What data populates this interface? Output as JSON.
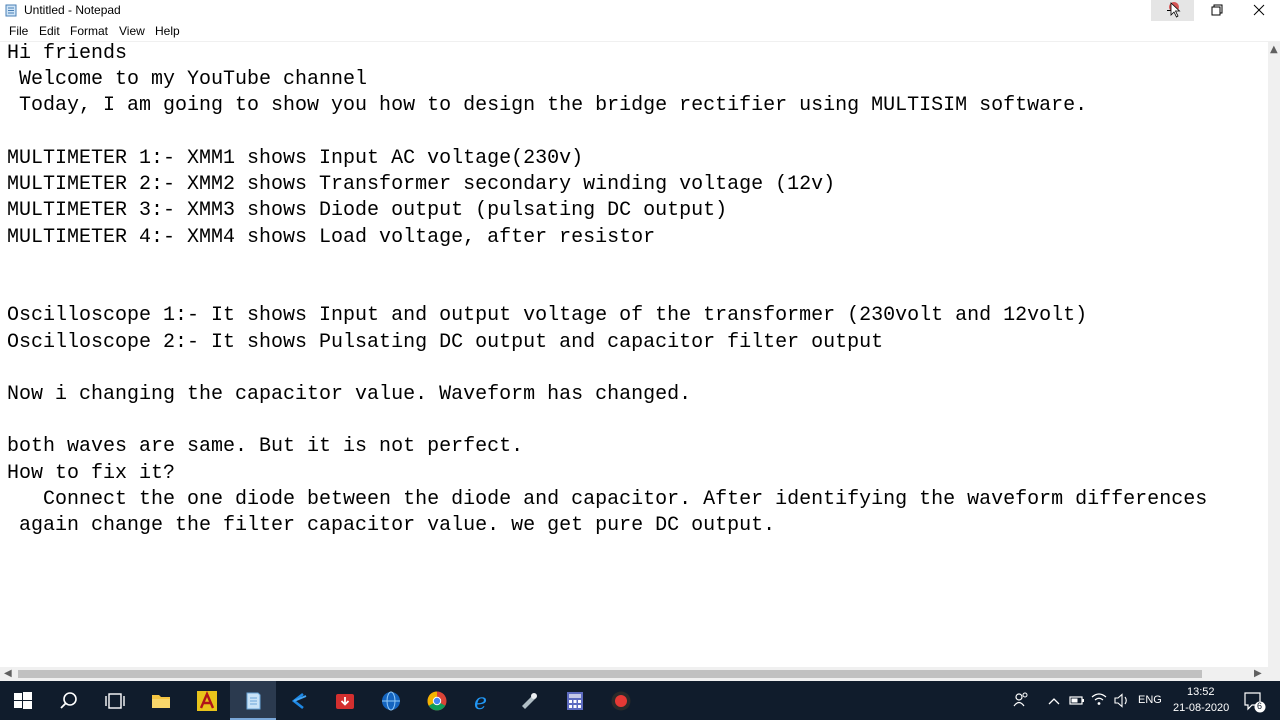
{
  "window": {
    "title": "Untitled - Notepad",
    "controls": {
      "minimize": "minimize",
      "maximize": "restore",
      "close": "close"
    }
  },
  "menu": [
    "File",
    "Edit",
    "Format",
    "View",
    "Help"
  ],
  "editor": {
    "lines": [
      "Hi friends",
      " Welcome to my YouTube channel",
      " Today, I am going to show you how to design the bridge rectifier using MULTISIM software.",
      "",
      "MULTIMETER 1:- XMM1 shows Input AC voltage(230v)",
      "MULTIMETER 2:- XMM2 shows Transformer secondary winding voltage (12v)",
      "MULTIMETER 3:- XMM3 shows Diode output (pulsating DC output)",
      "MULTIMETER 4:- XMM4 shows Load voltage, after resistor",
      "",
      "",
      "Oscilloscope 1:- It shows Input and output voltage of the transformer (230volt and 12volt)",
      "Oscilloscope 2:- It shows Pulsating DC output and capacitor filter output",
      "",
      "Now i changing the capacitor value. Waveform has changed.",
      "",
      "both waves are same. But it is not perfect.",
      "How to fix it?",
      "   Connect the one diode between the diode and capacitor. After identifying the waveform differences",
      " again change the filter capacitor value. we get pure DC output."
    ]
  },
  "taskbar": {
    "icons": [
      "windows-start-icon",
      "search-icon",
      "task-view-icon",
      "file-explorer-icon",
      "app-a-icon",
      "notepad-icon",
      "app-code-icon",
      "app-download-icon",
      "app-globe-icon",
      "chrome-icon",
      "edge-icon",
      "app-tool-icon",
      "app-calc-icon",
      "app-record-icon"
    ],
    "tray": {
      "language": "ENG",
      "time": "13:52",
      "date": "21-08-2020",
      "notifications_count": "6"
    }
  }
}
